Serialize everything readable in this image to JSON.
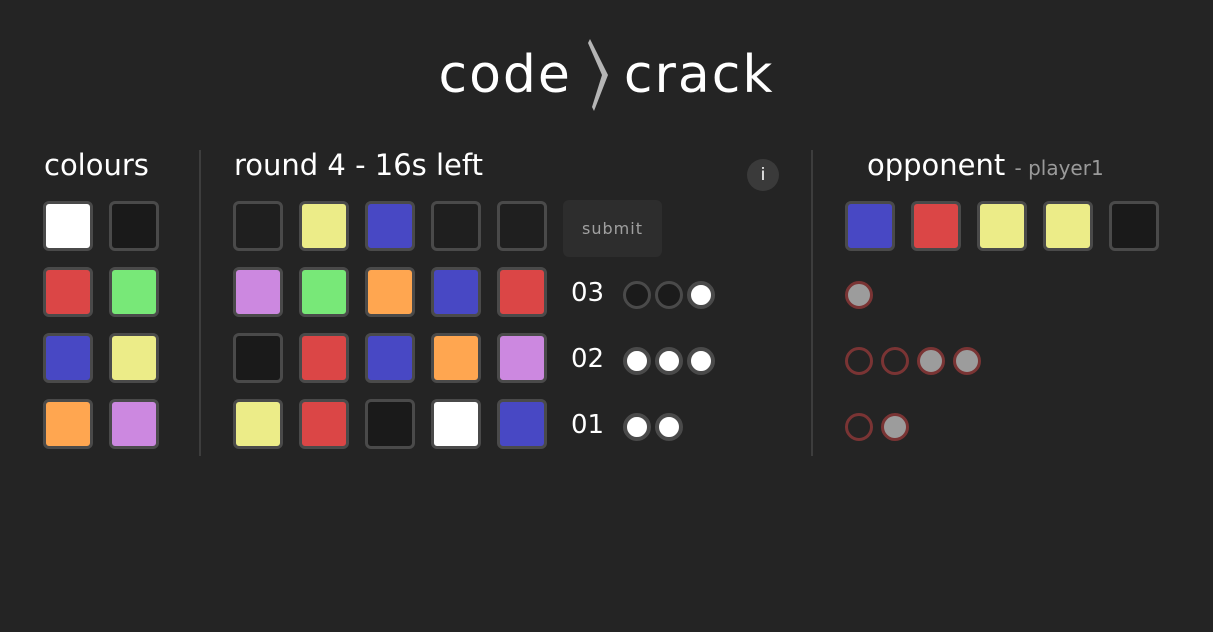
{
  "logo": {
    "left_word": "code",
    "right_word": "crack",
    "bolt_icon": "zigzag-bolt-icon",
    "bolt_color": "#b5b5b5"
  },
  "colours_panel": {
    "title": "colours",
    "swatches": [
      {
        "name": "white",
        "color": "#ffffff"
      },
      {
        "name": "black",
        "color": "#1a1a1a"
      },
      {
        "name": "red",
        "color": "#db4646"
      },
      {
        "name": "green",
        "color": "#78e878"
      },
      {
        "name": "blue",
        "color": "#4848c4"
      },
      {
        "name": "yellow",
        "color": "#ecec88"
      },
      {
        "name": "orange",
        "color": "#ffa650"
      },
      {
        "name": "purple",
        "color": "#cc88e0"
      }
    ]
  },
  "game": {
    "round_title": "round 4 - 16s left",
    "info_label": "i",
    "submit_label": "submit",
    "current_guess": [
      "#1f1f1f",
      "#ecec88",
      "#4848c4",
      "#1f1f1f",
      "#1f1f1f"
    ],
    "history": [
      {
        "number": "03",
        "colors": [
          "#cc88e0",
          "#78e878",
          "#ffa650",
          "#4848c4",
          "#db4646"
        ],
        "pegs": [
          "empty",
          "empty",
          "white"
        ]
      },
      {
        "number": "02",
        "colors": [
          "#1a1a1a",
          "#db4646",
          "#4848c4",
          "#ffa650",
          "#cc88e0"
        ],
        "pegs": [
          "white",
          "white",
          "white"
        ]
      },
      {
        "number": "01",
        "colors": [
          "#ecec88",
          "#db4646",
          "#1a1a1a",
          "#ffffff",
          "#4848c4"
        ],
        "pegs": [
          "white",
          "white"
        ]
      }
    ]
  },
  "opponent": {
    "title": "opponent",
    "player": "- player1",
    "code": [
      "#4848c4",
      "#db4646",
      "#ecec88",
      "#ecec88",
      "#1a1a1a"
    ],
    "feedback_rows": [
      [
        "grey"
      ],
      [
        "empty",
        "empty",
        "grey",
        "grey"
      ],
      [
        "empty",
        "grey"
      ]
    ]
  },
  "colors": {
    "background": "#242424",
    "tile_border": "#4a4a4a",
    "peg_border": "#4a4a4a",
    "opponent_peg_ring": "#7a3434",
    "opponent_peg_fill": "#9c9c9c"
  }
}
